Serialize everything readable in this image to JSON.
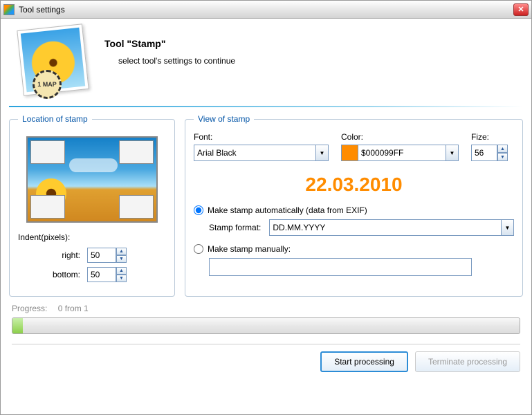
{
  "titlebar": {
    "title": "Tool settings"
  },
  "header": {
    "title": "Tool \"Stamp\"",
    "subtitle": "select tool's settings to continue",
    "stamp_text": "1 MAP"
  },
  "location": {
    "legend": "Location of stamp",
    "indent_label": "Indent(pixels):",
    "right_label": "right:",
    "right_value": "50",
    "bottom_label": "bottom:",
    "bottom_value": "50"
  },
  "view": {
    "legend": "View of stamp",
    "font_label": "Font:",
    "font_value": "Arial Black",
    "color_label": "Color:",
    "color_value": "$000099FF",
    "size_label": "Fize:",
    "size_value": "56",
    "preview_date": "22.03.2010",
    "auto_label": "Make stamp automatically (data from EXIF)",
    "format_label": "Stamp format:",
    "format_value": "DD.MM.YYYY",
    "manual_label": "Make stamp manually:",
    "manual_value": ""
  },
  "progress": {
    "label": "Progress:",
    "status": "0 from 1"
  },
  "buttons": {
    "start": "Start processing",
    "terminate": "Terminate processing"
  }
}
